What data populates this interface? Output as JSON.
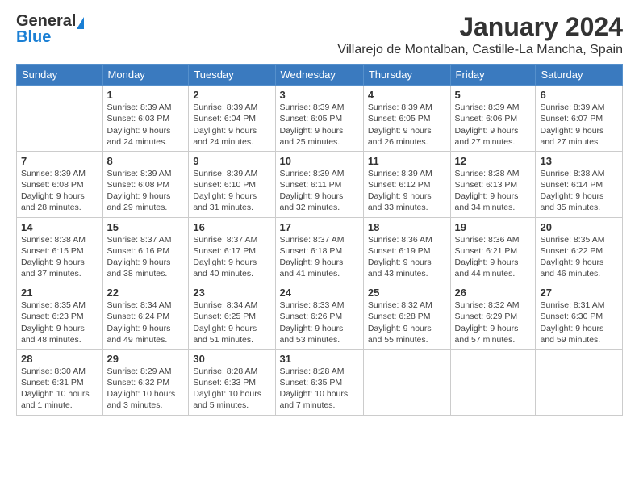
{
  "header": {
    "logo_general": "General",
    "logo_blue": "Blue",
    "month_year": "January 2024",
    "location": "Villarejo de Montalban, Castille-La Mancha, Spain"
  },
  "calendar": {
    "days_of_week": [
      "Sunday",
      "Monday",
      "Tuesday",
      "Wednesday",
      "Thursday",
      "Friday",
      "Saturday"
    ],
    "weeks": [
      [
        {
          "day": "",
          "info": ""
        },
        {
          "day": "1",
          "info": "Sunrise: 8:39 AM\nSunset: 6:03 PM\nDaylight: 9 hours\nand 24 minutes."
        },
        {
          "day": "2",
          "info": "Sunrise: 8:39 AM\nSunset: 6:04 PM\nDaylight: 9 hours\nand 24 minutes."
        },
        {
          "day": "3",
          "info": "Sunrise: 8:39 AM\nSunset: 6:05 PM\nDaylight: 9 hours\nand 25 minutes."
        },
        {
          "day": "4",
          "info": "Sunrise: 8:39 AM\nSunset: 6:05 PM\nDaylight: 9 hours\nand 26 minutes."
        },
        {
          "day": "5",
          "info": "Sunrise: 8:39 AM\nSunset: 6:06 PM\nDaylight: 9 hours\nand 27 minutes."
        },
        {
          "day": "6",
          "info": "Sunrise: 8:39 AM\nSunset: 6:07 PM\nDaylight: 9 hours\nand 27 minutes."
        }
      ],
      [
        {
          "day": "7",
          "info": ""
        },
        {
          "day": "8",
          "info": "Sunrise: 8:39 AM\nSunset: 6:08 PM\nDaylight: 9 hours\nand 29 minutes."
        },
        {
          "day": "9",
          "info": "Sunrise: 8:39 AM\nSunset: 6:10 PM\nDaylight: 9 hours\nand 31 minutes."
        },
        {
          "day": "10",
          "info": "Sunrise: 8:39 AM\nSunset: 6:11 PM\nDaylight: 9 hours\nand 32 minutes."
        },
        {
          "day": "11",
          "info": "Sunrise: 8:39 AM\nSunset: 6:12 PM\nDaylight: 9 hours\nand 33 minutes."
        },
        {
          "day": "12",
          "info": "Sunrise: 8:38 AM\nSunset: 6:13 PM\nDaylight: 9 hours\nand 34 minutes."
        },
        {
          "day": "13",
          "info": "Sunrise: 8:38 AM\nSunset: 6:14 PM\nDaylight: 9 hours\nand 35 minutes."
        }
      ],
      [
        {
          "day": "14",
          "info": ""
        },
        {
          "day": "15",
          "info": "Sunrise: 8:37 AM\nSunset: 6:16 PM\nDaylight: 9 hours\nand 38 minutes."
        },
        {
          "day": "16",
          "info": "Sunrise: 8:37 AM\nSunset: 6:17 PM\nDaylight: 9 hours\nand 40 minutes."
        },
        {
          "day": "17",
          "info": "Sunrise: 8:37 AM\nSunset: 6:18 PM\nDaylight: 9 hours\nand 41 minutes."
        },
        {
          "day": "18",
          "info": "Sunrise: 8:36 AM\nSunset: 6:19 PM\nDaylight: 9 hours\nand 43 minutes."
        },
        {
          "day": "19",
          "info": "Sunrise: 8:36 AM\nSunset: 6:21 PM\nDaylight: 9 hours\nand 44 minutes."
        },
        {
          "day": "20",
          "info": "Sunrise: 8:35 AM\nSunset: 6:22 PM\nDaylight: 9 hours\nand 46 minutes."
        }
      ],
      [
        {
          "day": "21",
          "info": ""
        },
        {
          "day": "22",
          "info": "Sunrise: 8:34 AM\nSunset: 6:24 PM\nDaylight: 9 hours\nand 49 minutes."
        },
        {
          "day": "23",
          "info": "Sunrise: 8:34 AM\nSunset: 6:25 PM\nDaylight: 9 hours\nand 51 minutes."
        },
        {
          "day": "24",
          "info": "Sunrise: 8:33 AM\nSunset: 6:26 PM\nDaylight: 9 hours\nand 53 minutes."
        },
        {
          "day": "25",
          "info": "Sunrise: 8:32 AM\nSunset: 6:28 PM\nDaylight: 9 hours\nand 55 minutes."
        },
        {
          "day": "26",
          "info": "Sunrise: 8:32 AM\nSunset: 6:29 PM\nDaylight: 9 hours\nand 57 minutes."
        },
        {
          "day": "27",
          "info": "Sunrise: 8:31 AM\nSunset: 6:30 PM\nDaylight: 9 hours\nand 59 minutes."
        }
      ],
      [
        {
          "day": "28",
          "info": ""
        },
        {
          "day": "29",
          "info": "Sunrise: 8:29 AM\nSunset: 6:32 PM\nDaylight: 10 hours\nand 3 minutes."
        },
        {
          "day": "30",
          "info": "Sunrise: 8:28 AM\nSunset: 6:33 PM\nDaylight: 10 hours\nand 5 minutes."
        },
        {
          "day": "31",
          "info": "Sunrise: 8:28 AM\nSunset: 6:35 PM\nDaylight: 10 hours\nand 7 minutes."
        },
        {
          "day": "",
          "info": ""
        },
        {
          "day": "",
          "info": ""
        },
        {
          "day": "",
          "info": ""
        }
      ]
    ],
    "week1_sun_info": "Sunrise: 8:39 AM\nSunset: 6:08 PM\nDaylight: 9 hours\nand 28 minutes.",
    "week2_sun_info": "Sunrise: 8:38 AM\nSunset: 6:15 PM\nDaylight: 9 hours\nand 37 minutes.",
    "week3_sun_info": "Sunrise: 8:35 AM\nSunset: 6:23 PM\nDaylight: 9 hours\nand 48 minutes.",
    "week4_sun_info": "Sunrise: 8:30 AM\nSunset: 6:31 PM\nDaylight: 10 hours\nand 1 minute."
  }
}
